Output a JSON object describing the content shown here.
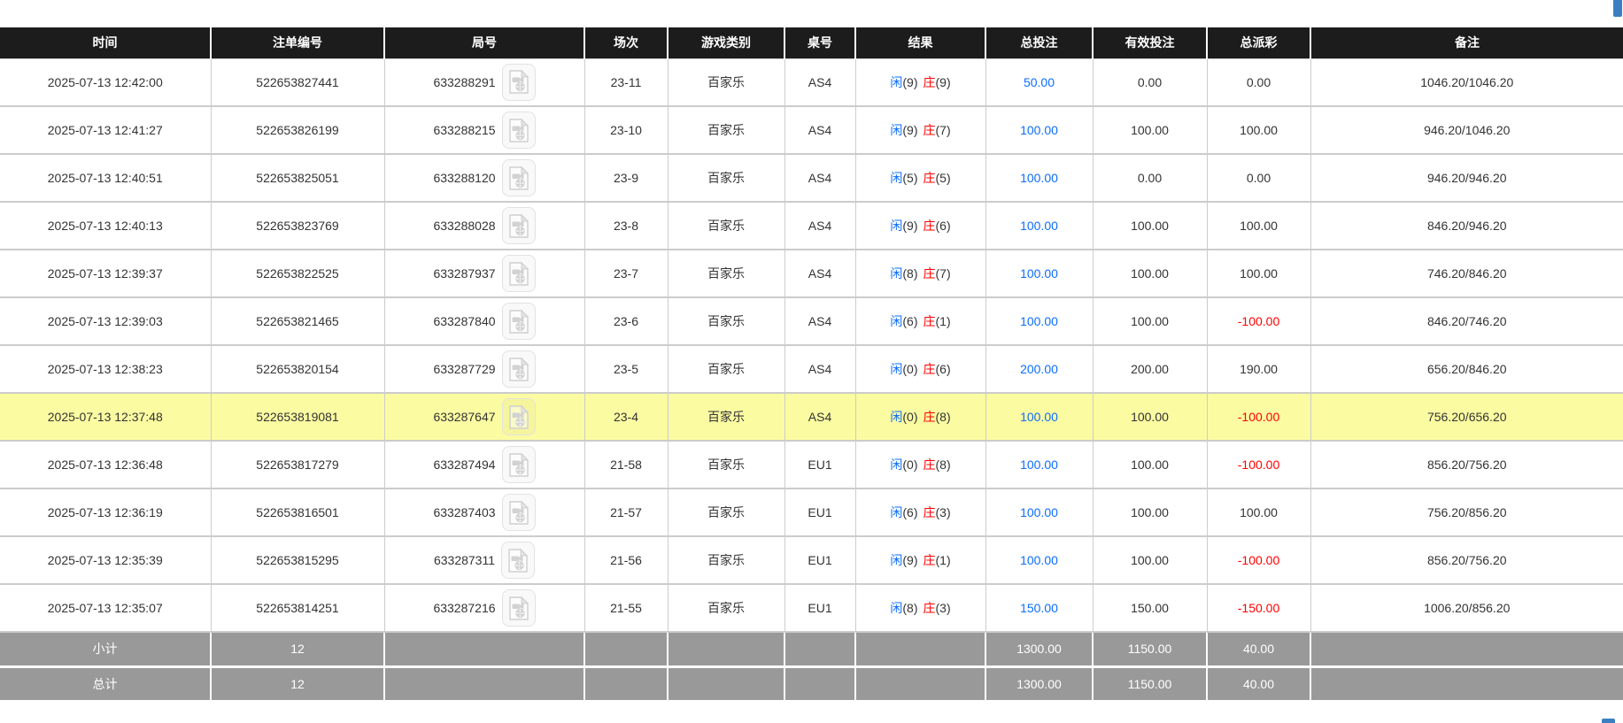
{
  "labels": {
    "player": "闲",
    "banker": "庄"
  },
  "colors": {
    "header_bg": "#1c1c1c",
    "highlight_row": "#fbfba2",
    "footer_bg": "#999999",
    "link_blue": "#0d6efd",
    "negative_red": "#ff0000",
    "floating_button_blue": "#3d7ec0"
  },
  "table": {
    "columns": [
      {
        "label": "时间"
      },
      {
        "label": "注单编号"
      },
      {
        "label": "局号"
      },
      {
        "label": "场次"
      },
      {
        "label": "游戏类别"
      },
      {
        "label": "桌号"
      },
      {
        "label": "结果"
      },
      {
        "label": "总投注"
      },
      {
        "label": "有效投注"
      },
      {
        "label": "总派彩"
      },
      {
        "label": "备注"
      }
    ],
    "rows": [
      {
        "time": "2025-07-13 12:42:00",
        "bet_id": "522653827441",
        "round": "633288291",
        "session": "23-11",
        "game_type": "百家乐",
        "table_no": "AS4",
        "player_score": "(9)",
        "banker_score": "(9)",
        "total_bet": "50.00",
        "valid_bet": "0.00",
        "payout": "0.00",
        "remark": "1046.20/1046.20",
        "highlight": false
      },
      {
        "time": "2025-07-13 12:41:27",
        "bet_id": "522653826199",
        "round": "633288215",
        "session": "23-10",
        "game_type": "百家乐",
        "table_no": "AS4",
        "player_score": "(9)",
        "banker_score": "(7)",
        "total_bet": "100.00",
        "valid_bet": "100.00",
        "payout": "100.00",
        "remark": "946.20/1046.20",
        "highlight": false
      },
      {
        "time": "2025-07-13 12:40:51",
        "bet_id": "522653825051",
        "round": "633288120",
        "session": "23-9",
        "game_type": "百家乐",
        "table_no": "AS4",
        "player_score": "(5)",
        "banker_score": "(5)",
        "total_bet": "100.00",
        "valid_bet": "0.00",
        "payout": "0.00",
        "remark": "946.20/946.20",
        "highlight": false
      },
      {
        "time": "2025-07-13 12:40:13",
        "bet_id": "522653823769",
        "round": "633288028",
        "session": "23-8",
        "game_type": "百家乐",
        "table_no": "AS4",
        "player_score": "(9)",
        "banker_score": "(6)",
        "total_bet": "100.00",
        "valid_bet": "100.00",
        "payout": "100.00",
        "remark": "846.20/946.20",
        "highlight": false
      },
      {
        "time": "2025-07-13 12:39:37",
        "bet_id": "522653822525",
        "round": "633287937",
        "session": "23-7",
        "game_type": "百家乐",
        "table_no": "AS4",
        "player_score": "(8)",
        "banker_score": "(7)",
        "total_bet": "100.00",
        "valid_bet": "100.00",
        "payout": "100.00",
        "remark": "746.20/846.20",
        "highlight": false
      },
      {
        "time": "2025-07-13 12:39:03",
        "bet_id": "522653821465",
        "round": "633287840",
        "session": "23-6",
        "game_type": "百家乐",
        "table_no": "AS4",
        "player_score": "(6)",
        "banker_score": "(1)",
        "total_bet": "100.00",
        "valid_bet": "100.00",
        "payout": "-100.00",
        "remark": "846.20/746.20",
        "highlight": false
      },
      {
        "time": "2025-07-13 12:38:23",
        "bet_id": "522653820154",
        "round": "633287729",
        "session": "23-5",
        "game_type": "百家乐",
        "table_no": "AS4",
        "player_score": "(0)",
        "banker_score": "(6)",
        "total_bet": "200.00",
        "valid_bet": "200.00",
        "payout": "190.00",
        "remark": "656.20/846.20",
        "highlight": false
      },
      {
        "time": "2025-07-13 12:37:48",
        "bet_id": "522653819081",
        "round": "633287647",
        "session": "23-4",
        "game_type": "百家乐",
        "table_no": "AS4",
        "player_score": "(0)",
        "banker_score": "(8)",
        "total_bet": "100.00",
        "valid_bet": "100.00",
        "payout": "-100.00",
        "remark": "756.20/656.20",
        "highlight": true
      },
      {
        "time": "2025-07-13 12:36:48",
        "bet_id": "522653817279",
        "round": "633287494",
        "session": "21-58",
        "game_type": "百家乐",
        "table_no": "EU1",
        "player_score": "(0)",
        "banker_score": "(8)",
        "total_bet": "100.00",
        "valid_bet": "100.00",
        "payout": "-100.00",
        "remark": "856.20/756.20",
        "highlight": false
      },
      {
        "time": "2025-07-13 12:36:19",
        "bet_id": "522653816501",
        "round": "633287403",
        "session": "21-57",
        "game_type": "百家乐",
        "table_no": "EU1",
        "player_score": "(6)",
        "banker_score": "(3)",
        "total_bet": "100.00",
        "valid_bet": "100.00",
        "payout": "100.00",
        "remark": "756.20/856.20",
        "highlight": false
      },
      {
        "time": "2025-07-13 12:35:39",
        "bet_id": "522653815295",
        "round": "633287311",
        "session": "21-56",
        "game_type": "百家乐",
        "table_no": "EU1",
        "player_score": "(9)",
        "banker_score": "(1)",
        "total_bet": "100.00",
        "valid_bet": "100.00",
        "payout": "-100.00",
        "remark": "856.20/756.20",
        "highlight": false
      },
      {
        "time": "2025-07-13 12:35:07",
        "bet_id": "522653814251",
        "round": "633287216",
        "session": "21-55",
        "game_type": "百家乐",
        "table_no": "EU1",
        "player_score": "(8)",
        "banker_score": "(3)",
        "total_bet": "150.00",
        "valid_bet": "150.00",
        "payout": "-150.00",
        "remark": "1006.20/856.20",
        "highlight": false
      }
    ],
    "footer": [
      {
        "label": "小计",
        "count": "12",
        "total_bet": "1300.00",
        "valid_bet": "1150.00",
        "payout": "40.00"
      },
      {
        "label": "总计",
        "count": "12",
        "total_bet": "1300.00",
        "valid_bet": "1150.00",
        "payout": "40.00"
      }
    ]
  }
}
